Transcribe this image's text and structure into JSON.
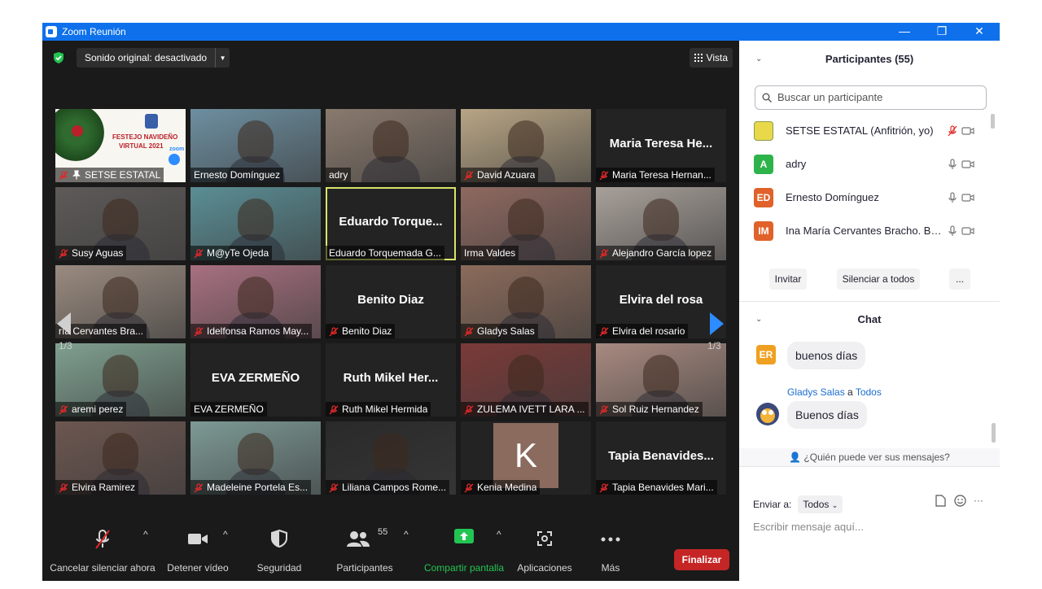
{
  "window": {
    "title": "Zoom Reunión",
    "controls": [
      "—",
      "❐",
      "✕"
    ]
  },
  "top": {
    "sound_label": "Sonido original: desactivado",
    "vista_label": "Vista"
  },
  "pager": {
    "left": "1/3",
    "right": "1/3"
  },
  "tiles": [
    {
      "name": "SETSE ESTATAL",
      "muted": true,
      "pinned": true,
      "kind": "banner",
      "banner_line1": "FESTEJO NAVIDEÑO",
      "banner_line2": "VIRTUAL 2021",
      "banner_logo": "zoom"
    },
    {
      "name": "Ernesto Domínguez",
      "muted": false,
      "kind": "video",
      "bg": "#6d8fa0"
    },
    {
      "name": "adry",
      "muted": false,
      "kind": "video",
      "bg": "#8a7a6e"
    },
    {
      "name": "David Azuara",
      "muted": true,
      "kind": "video",
      "bg": "#b8a585"
    },
    {
      "name": "Maria Teresa Hernan...",
      "muted": true,
      "kind": "text",
      "big": "Maria  Teresa  He..."
    },
    {
      "name": "Susy Aguas",
      "muted": true,
      "kind": "video",
      "bg": "#5d5a58"
    },
    {
      "name": "M@yTe Ojeda",
      "muted": true,
      "kind": "video",
      "bg": "#5a8e95"
    },
    {
      "name": "Eduardo Torquemada G...",
      "muted": false,
      "kind": "text",
      "big": "Eduardo  Torque...",
      "active": true
    },
    {
      "name": "Irma Valdes",
      "muted": false,
      "kind": "video",
      "bg": "#8e6960"
    },
    {
      "name": "Alejandro García lopez",
      "muted": true,
      "kind": "video",
      "bg": "#a8a09a"
    },
    {
      "name": "ría Cervantes Bra...",
      "muted": false,
      "kind": "video",
      "bg": "#9a8b80"
    },
    {
      "name": "Idelfonsa Ramos May...",
      "muted": true,
      "kind": "video",
      "bg": "#a87080"
    },
    {
      "name": "Benito Diaz",
      "muted": true,
      "kind": "text",
      "big": "Benito Diaz"
    },
    {
      "name": "Gladys Salas",
      "muted": true,
      "kind": "video",
      "bg": "#8b6b5b"
    },
    {
      "name": "Elvira del rosario",
      "muted": true,
      "kind": "text",
      "big": "Elvira del rosa"
    },
    {
      "name": "aremi perez",
      "muted": true,
      "kind": "video",
      "bg": "#7fa090"
    },
    {
      "name": "EVA ZERMEÑO",
      "muted": false,
      "kind": "text",
      "big": "EVA ZERMEÑO"
    },
    {
      "name": "Ruth Mikel Hermida",
      "muted": true,
      "kind": "text",
      "big": "Ruth  Mikel  Her..."
    },
    {
      "name": "ZULEMA IVETT LARA ...",
      "muted": true,
      "kind": "video",
      "bg": "#7a3a38"
    },
    {
      "name": "Sol Ruiz Hernandez",
      "muted": true,
      "kind": "video",
      "bg": "#a88a80"
    },
    {
      "name": "Elvira Ramirez",
      "muted": true,
      "kind": "video",
      "bg": "#6c5650"
    },
    {
      "name": "Madeleine Portela Es...",
      "muted": true,
      "kind": "video",
      "bg": "#7d9a96"
    },
    {
      "name": "Liliana Campos Rome...",
      "muted": true,
      "kind": "video",
      "bg": "#2a2a2a"
    },
    {
      "name": "Kenia Medina",
      "muted": true,
      "kind": "avatar",
      "initial": "K"
    },
    {
      "name": "Tapia Benavides Mari...",
      "muted": true,
      "kind": "text",
      "big": "Tapia  Benavides..."
    }
  ],
  "toolbar": {
    "mute_label": "Cancelar silenciar ahora",
    "video_label": "Detener vídeo",
    "security_label": "Seguridad",
    "participants_label": "Participantes",
    "participants_count": "55",
    "share_label": "Compartir pantalla",
    "apps_label": "Aplicaciones",
    "more_label": "Más",
    "end_label": "Finalizar"
  },
  "participants": {
    "header": "Participantes (55)",
    "search_placeholder": "Buscar un participante",
    "list": [
      {
        "name": "SETSE ESTATAL (Anfitrión, yo)",
        "initials": "",
        "color": "#e8d84a",
        "mic_muted": true
      },
      {
        "name": "adry",
        "initials": "A",
        "color": "#2db34a",
        "mic_muted": false
      },
      {
        "name": "Ernesto Domínguez",
        "initials": "ED",
        "color": "#e0622a",
        "mic_muted": false
      },
      {
        "name": "Ina María Cervantes Bracho. Bo...",
        "initials": "IM",
        "color": "#e0622a",
        "mic_muted": false
      }
    ],
    "invite_label": "Invitar",
    "mute_all_label": "Silenciar a todos",
    "more_label": "..."
  },
  "chat": {
    "header": "Chat",
    "messages": [
      {
        "initials": "ER",
        "color": "#f0a020",
        "text": "buenos días",
        "sender": ""
      },
      {
        "sender": "Gladys Salas",
        "to_word": " a ",
        "to": "Todos",
        "text": "Buenos días"
      }
    ],
    "who_can_see": "¿Quién puede ver sus mensajes?",
    "send_to_label": "Enviar a:",
    "send_to_value": "Todos",
    "input_placeholder": "Escribir mensaje aquí..."
  }
}
